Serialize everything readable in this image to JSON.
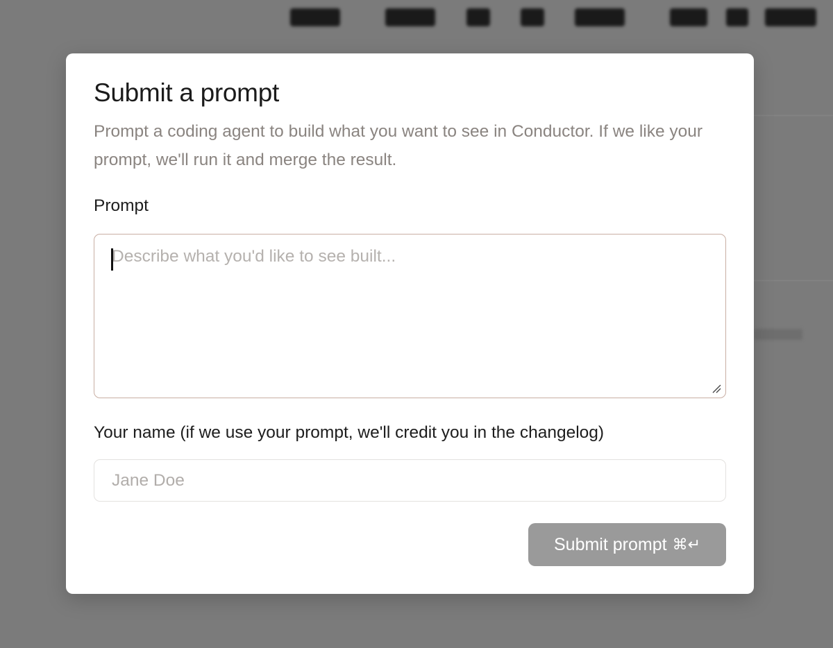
{
  "modal": {
    "title": "Submit a prompt",
    "description": "Prompt a coding agent to build what you want to see in Conductor. If we like your prompt, we'll run it and merge the result.",
    "prompt_label": "Prompt",
    "prompt_placeholder": "Describe what you'd like to see built...",
    "prompt_value": "",
    "name_label": "Your name (if we use your prompt, we'll credit you in the changelog)",
    "name_placeholder": "Jane Doe",
    "name_value": "",
    "submit_label": "Submit prompt",
    "submit_shortcut": "⌘↵",
    "submit_enabled": false
  },
  "colors": {
    "backdrop": "#7b7b7b",
    "modal_bg": "#ffffff",
    "title": "#1b1b1b",
    "description": "#8a8480",
    "prompt_border_focused": "#c8aea3",
    "input_border": "#e3e1df",
    "placeholder": "#b5b1ae",
    "submit_disabled_bg": "#9a9a9a",
    "submit_text": "#ffffff"
  }
}
